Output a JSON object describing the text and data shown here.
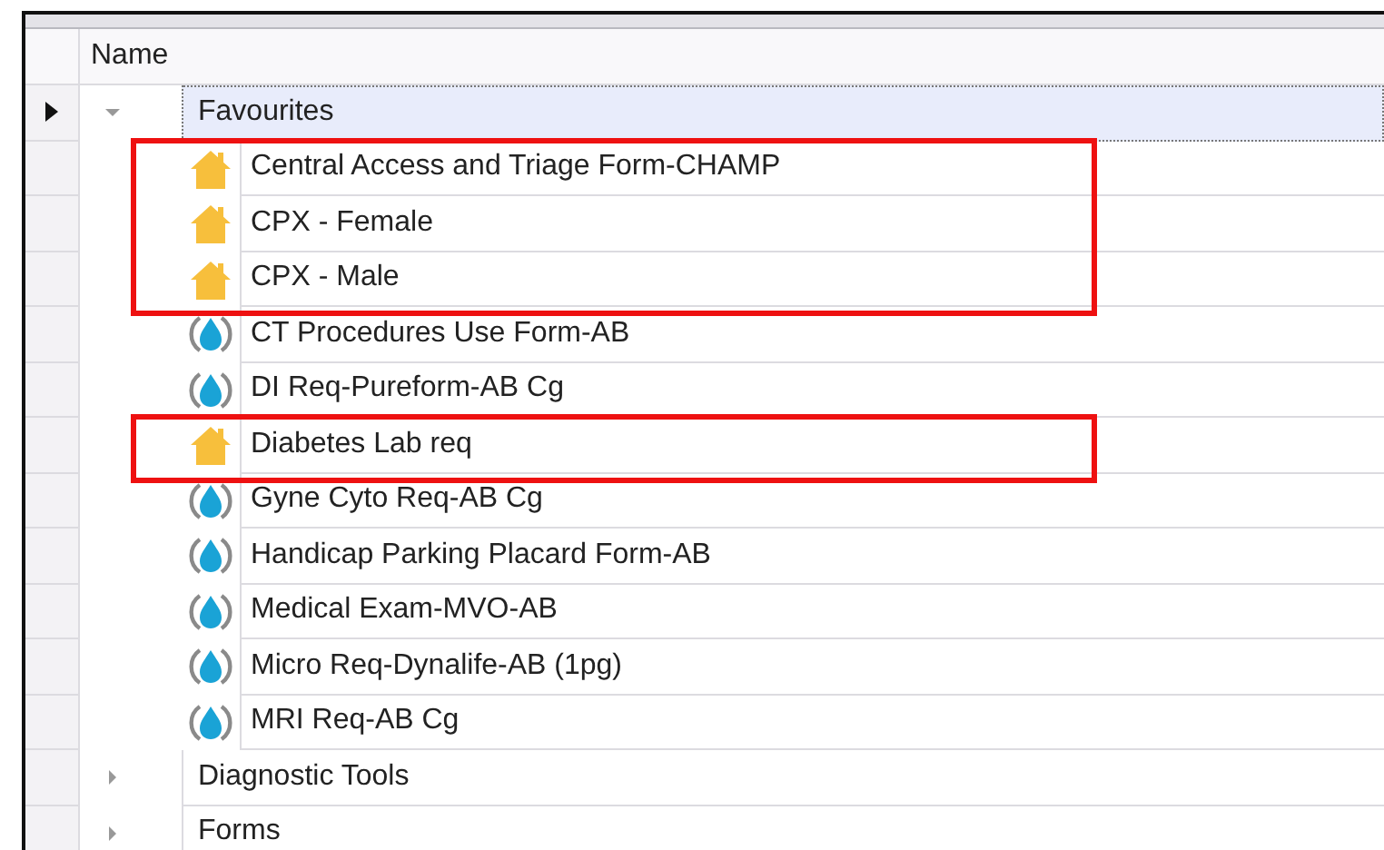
{
  "table": {
    "columns": [
      {
        "label": "Name"
      }
    ],
    "groups": [
      {
        "label": "Favourites",
        "expanded": true,
        "selected": true,
        "children": [
          {
            "label": "Central Access and Triage Form-CHAMP",
            "kind": "favourite",
            "selected": false,
            "highlighted": true
          },
          {
            "label": "CPX - Female",
            "kind": "favourite",
            "selected": false,
            "highlighted": true
          },
          {
            "label": "CPX - Male",
            "kind": "favourite",
            "selected": false,
            "highlighted": true
          },
          {
            "label": "CT Procedures Use Form-AB",
            "kind": "form",
            "selected": false,
            "highlighted": false
          },
          {
            "label": "DI Req-Pureform-AB Cg",
            "kind": "form",
            "selected": false,
            "highlighted": false
          },
          {
            "label": "Diabetes Lab req",
            "kind": "favourite",
            "selected": false,
            "highlighted": true
          },
          {
            "label": "Gyne Cyto Req-AB Cg",
            "kind": "form",
            "selected": false,
            "highlighted": false
          },
          {
            "label": "Handicap Parking Placard Form-AB",
            "kind": "form",
            "selected": false,
            "highlighted": false
          },
          {
            "label": "Medical Exam-MVO-AB",
            "kind": "form",
            "selected": false,
            "highlighted": false
          },
          {
            "label": "Micro Req-Dynalife-AB (1pg)",
            "kind": "form",
            "selected": false,
            "highlighted": false
          },
          {
            "label": "MRI Req-AB Cg",
            "kind": "form",
            "selected": false,
            "highlighted": false
          }
        ]
      },
      {
        "label": "Diagnostic Tools",
        "expanded": false,
        "selected": false
      },
      {
        "label": "Forms",
        "expanded": false,
        "selected": false
      }
    ]
  }
}
